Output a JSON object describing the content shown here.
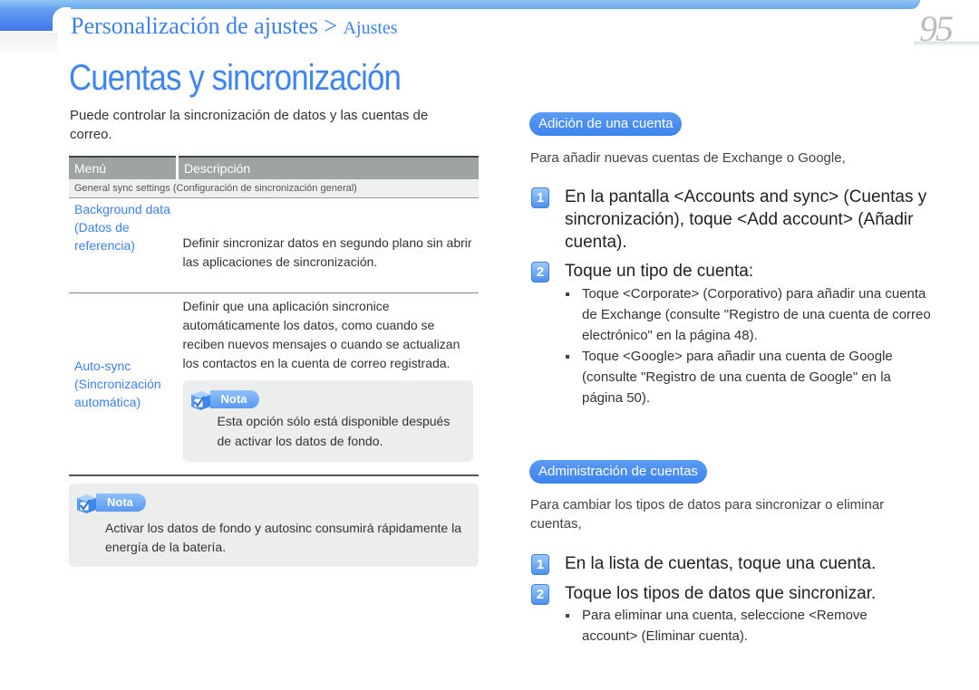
{
  "header": {
    "breadcrumb_main": "Personalización de ajustes > ",
    "breadcrumb_sub": "Ajustes",
    "page_number": "95"
  },
  "title": "Cuentas y sincronización",
  "intro": "Puede controlar la sincronización de datos y las cuentas de correo.",
  "table": {
    "headers": [
      "Menú",
      "Descripción"
    ],
    "section": "General sync settings (Configuración de sincronización general)",
    "rows": [
      {
        "menu": "Background data (Datos de referencia)",
        "description": "Definir sincronizar datos en segundo plano sin abrir las aplicaciones de sincronización."
      },
      {
        "menu": "Auto-sync (Sincronización automática)",
        "description": "Definir que una aplicación sincronice automáticamente los datos, como cuando se reciben nuevos mensajes o cuando se actualizan los contactos en la cuenta de correo registrada.",
        "note": "Esta opción sólo está disponible después de activar los datos de fondo."
      }
    ]
  },
  "nota_label": "Nota",
  "bottom_note": "Activar los datos de fondo y autosinc consumirá rápidamente la energía de la batería.",
  "sections": [
    {
      "heading": "Adición de una cuenta",
      "intro": "Para añadir nuevas cuentas de Exchange o Google,",
      "steps": [
        {
          "num": "1",
          "text": "En la pantalla <Accounts and sync> (Cuentas y sincronización), toque <Add account> (Añadir cuenta)."
        },
        {
          "num": "2",
          "text": "Toque un tipo de cuenta:"
        }
      ],
      "bullets": [
        "Toque <Corporate> (Corporativo) para añadir una cuenta de Exchange (consulte \"Registro de una cuenta de correo electrónico\" en la página 48).",
        "Toque <Google> para añadir una cuenta de Google (consulte \"Registro de una cuenta de Google\" en la página 50)."
      ]
    },
    {
      "heading": "Administración de cuentas",
      "intro": "Para cambiar los tipos de datos para sincronizar o eliminar cuentas,",
      "steps": [
        {
          "num": "1",
          "text": "En la lista de cuentas, toque una cuenta."
        },
        {
          "num": "2",
          "text": "Toque los tipos de datos que sincronizar."
        }
      ],
      "bullets": [
        "Para eliminar una cuenta, seleccione <Remove account> (Eliminar cuenta)."
      ]
    }
  ]
}
